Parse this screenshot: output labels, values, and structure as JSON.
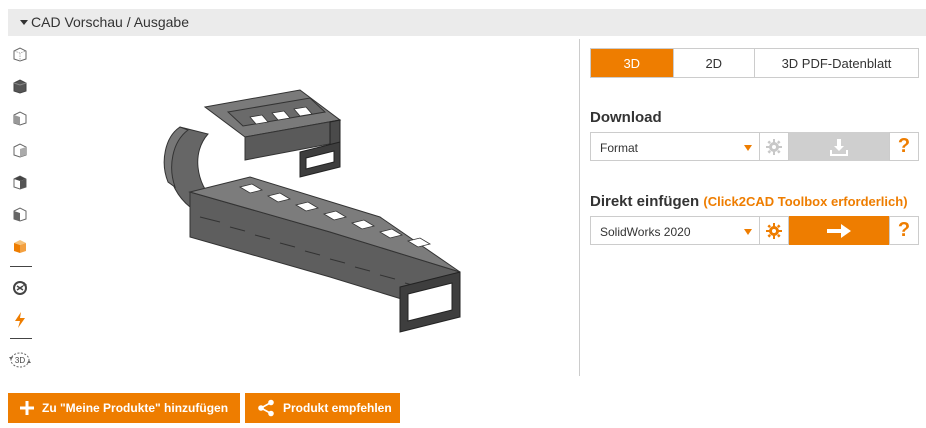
{
  "panel": {
    "title": "CAD Vorschau / Ausgabe"
  },
  "toolbar": {
    "icons": [
      "view-iso-wireframe-icon",
      "view-iso-solid-icon",
      "view-front-icon",
      "view-side-icon",
      "view-top-icon",
      "view-left-icon",
      "view-shaded-icon",
      "rotate-icon",
      "lightning-icon",
      "rotate-3d-icon"
    ],
    "rotate3d_label": "3D"
  },
  "tabs": [
    {
      "label": "3D",
      "active": true
    },
    {
      "label": "2D",
      "active": false
    },
    {
      "label": "3D PDF-Datenblatt",
      "active": false
    }
  ],
  "download": {
    "title": "Download",
    "format_value": "Format",
    "help": "?"
  },
  "direct": {
    "title": "Direkt einfügen",
    "note": "(Click2CAD Toolbox erforderlich)",
    "cad_value": "SolidWorks 2020",
    "help": "?"
  },
  "actions": {
    "add_label": "Zu \"Meine Produkte\" hinzufügen",
    "recommend_label": "Produkt empfehlen"
  },
  "colors": {
    "accent": "#ee7d00",
    "disabled": "#cfcfcf",
    "header_bg": "#ebebeb"
  }
}
